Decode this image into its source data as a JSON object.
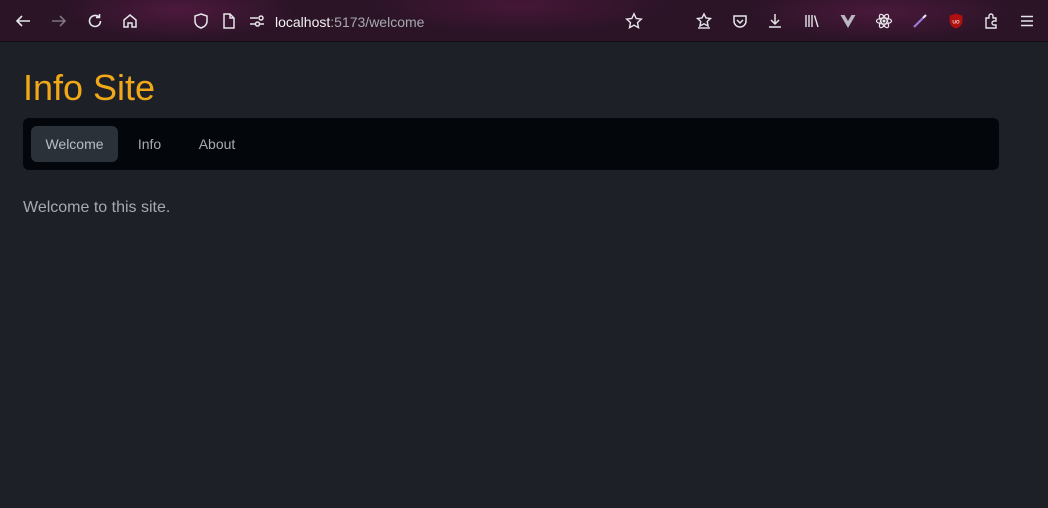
{
  "browser": {
    "url_host": "localhost",
    "url_path": ":5173/welcome",
    "icons": [
      "back-arrow-icon",
      "forward-arrow-icon",
      "reload-icon",
      "home-icon",
      "shield-icon",
      "page-icon",
      "permissions-icon",
      "bookmark-star-icon",
      "bookmarks-menu-icon",
      "pocket-icon",
      "download-icon",
      "library-icon",
      "vue-devtools-icon",
      "react-devtools-icon",
      "color-picker-icon",
      "ublock-icon",
      "extensions-icon",
      "hamburger-menu-icon"
    ]
  },
  "site": {
    "title": "Info Site",
    "title_color": "#f0a818",
    "nav": {
      "items": [
        {
          "label": "Welcome",
          "active": true
        },
        {
          "label": "Info",
          "active": false
        },
        {
          "label": "About",
          "active": false
        }
      ]
    },
    "content": {
      "text": "Welcome to this site."
    }
  }
}
